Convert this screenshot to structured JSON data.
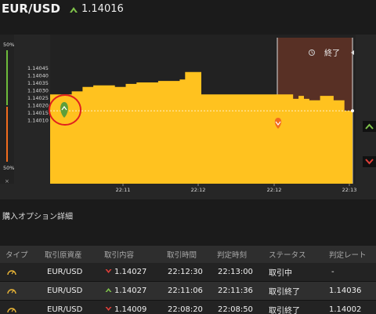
{
  "header": {
    "pair": "EUR/USD",
    "direction_icon": "arrow-up-icon",
    "rate": "1.14016"
  },
  "chart": {
    "side_top_pct": "50%",
    "side_bottom_pct": "50%",
    "close_label": "×",
    "end_label": "終了",
    "end_icon": "refresh-icon",
    "colors": {
      "area": "#ffc21f",
      "expired_zone": "#5c3226",
      "marker_green": "#5e9e3a",
      "marker_orange": "#f26c1e",
      "highlight_circle": "#e0201e"
    }
  },
  "chart_data": {
    "type": "area",
    "y_ticks": [
      "1.14045",
      "1.14040",
      "1.14035",
      "1.14030",
      "1.14025",
      "1.14020",
      "1.14015",
      "1.14010"
    ],
    "x_ticks": [
      "22:11",
      "22:12",
      "22:12",
      "22:13"
    ],
    "ylim": [
      1.14005,
      1.14048
    ],
    "current_rate": 1.14016,
    "series": [
      {
        "x": [
          0,
          0.04,
          0.08,
          0.12,
          0.16,
          0.2,
          0.24,
          0.28,
          0.32,
          0.36,
          0.4,
          0.44,
          0.48,
          0.5,
          0.56,
          0.6,
          0.64,
          0.66,
          0.68,
          0.72,
          0.76,
          0.8,
          0.84,
          0.86,
          0.9,
          0.92,
          0.94,
          0.96,
          1.0,
          1.05,
          1.09,
          1.12
        ],
        "y": [
          1.14027,
          1.14027,
          1.14029,
          1.14032,
          1.14033,
          1.14033,
          1.14032,
          1.14034,
          1.14035,
          1.14035,
          1.14036,
          1.14036,
          1.14037,
          1.14042,
          1.14027,
          1.14027,
          1.14027,
          1.14027,
          1.14027,
          1.14027,
          1.14027,
          1.14027,
          1.14027,
          1.14027,
          1.14024,
          1.14026,
          1.14024,
          1.14023,
          1.14026,
          1.14023,
          1.14016,
          1.14016
        ]
      }
    ]
  },
  "section": {
    "title": "購入オプション詳細"
  },
  "table": {
    "headers": [
      "タイプ",
      "取引原資産",
      "取引内容",
      "取引時間",
      "判定時刻",
      "ステータス",
      "判定レート"
    ],
    "rows": [
      {
        "type_icon": "gauge-icon",
        "asset": "EUR/USD",
        "dir_icon": "arrow-down-icon",
        "content": "1.14027",
        "trade_time": "22:12:30",
        "judge_time": "22:13:00",
        "status": "取引中",
        "judge_rate": "-"
      },
      {
        "type_icon": "gauge-icon",
        "asset": "EUR/USD",
        "dir_icon": "arrow-up-icon",
        "content": "1.14027",
        "trade_time": "22:11:06",
        "judge_time": "22:11:36",
        "status": "取引終了",
        "judge_rate": "1.14036"
      },
      {
        "type_icon": "gauge-icon",
        "asset": "EUR/USD",
        "dir_icon": "arrow-down-icon",
        "content": "1.14009",
        "trade_time": "22:08:20",
        "judge_time": "22:08:50",
        "status": "取引終了",
        "judge_rate": "1.14002"
      }
    ]
  }
}
